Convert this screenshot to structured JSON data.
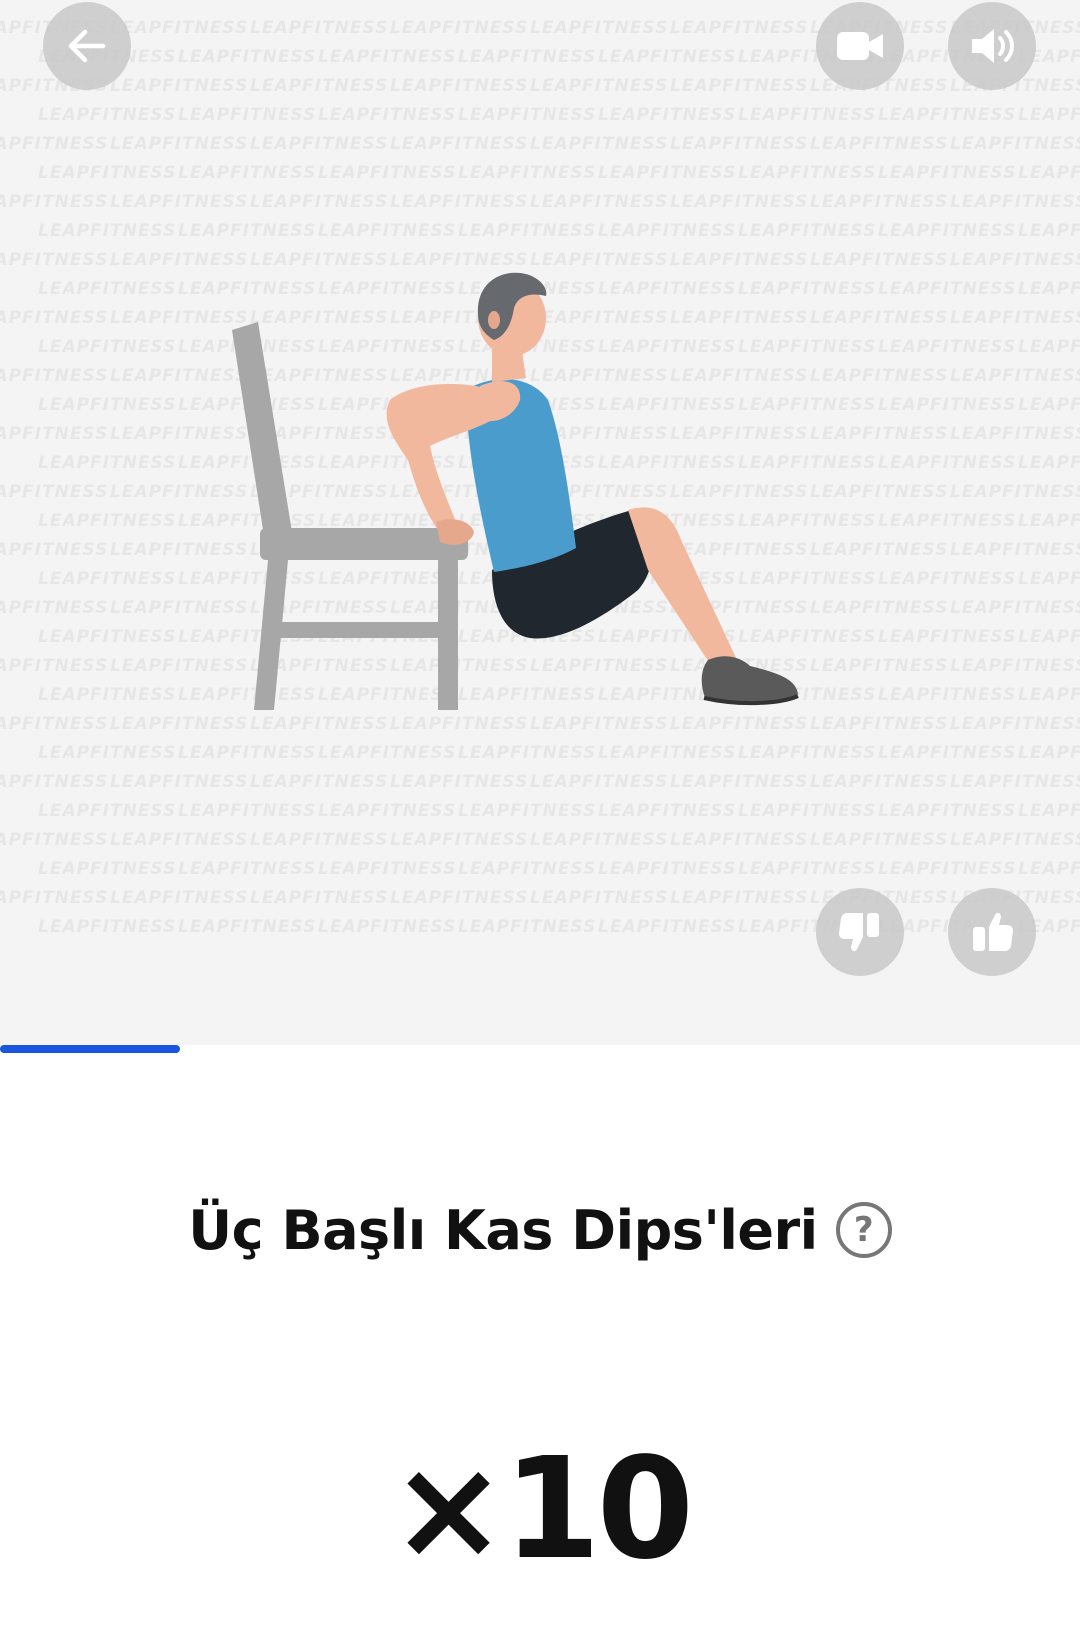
{
  "demo": {
    "watermark_text": "LEAPFITNESS",
    "back_icon": "arrow-left-icon",
    "video_icon": "video-camera-icon",
    "sound_icon": "speaker-volume-icon",
    "dislike_icon": "thumbs-down-icon",
    "like_icon": "thumbs-up-icon"
  },
  "progress": {
    "value_fraction": 0.167,
    "color": "#1a56e0"
  },
  "exercise": {
    "title": "Üç Başlı Kas Dips'leri",
    "help_symbol": "?",
    "reps": "×10"
  }
}
